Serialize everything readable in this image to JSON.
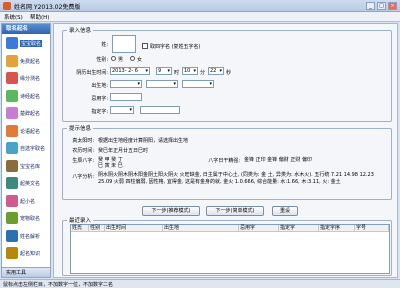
{
  "window": {
    "title": "姓名网 Y2013.02免费版",
    "btn_min": "_",
    "btn_max": "□",
    "btn_close": "×"
  },
  "menu": [
    "系统(S)",
    "帮助(H)"
  ],
  "sidebar": {
    "header": "取名起名",
    "items": [
      {
        "label": "宝宝取名",
        "color": "#3d7bd6"
      },
      {
        "label": "免费起名",
        "color": "#e6a23a"
      },
      {
        "label": "缘分测名",
        "color": "#d9534f"
      },
      {
        "label": "诗经起名",
        "color": "#5cb85c"
      },
      {
        "label": "楚辞起名",
        "color": "#c77dd4"
      },
      {
        "label": "论语起名",
        "color": "#e07b39"
      },
      {
        "label": "自选字取名",
        "color": "#4aa3c8"
      },
      {
        "label": "宝宝名库",
        "color": "#8a6d3b"
      },
      {
        "label": "起英文名",
        "color": "#3b8a7a"
      },
      {
        "label": "起小名",
        "color": "#d15b8f"
      },
      {
        "label": "宠物取名",
        "color": "#6b9e2e"
      },
      {
        "label": "姓名解析",
        "color": "#2c6fb2"
      },
      {
        "label": "起名知识",
        "color": "#b8860b"
      }
    ],
    "footer": "实用工具"
  },
  "form": {
    "legend_info": "录入信息",
    "surname_label": "姓:",
    "surname_value": "",
    "compound_label": "取四字名 (复姓五字名)",
    "gender_label": "性别:",
    "gender_male": "男",
    "gender_female": "女",
    "birth_label": "阴历出生时间:",
    "birth_date": "2013- 2- 6",
    "hour": "9",
    "hour_unit": "时",
    "minute": "10",
    "minute_unit": "分",
    "second": "22",
    "second_unit": "秒",
    "birthplace_label": "出生地:",
    "avoid_label": "忌用字:",
    "fixed_label": "指定字:"
  },
  "tips": {
    "legend": "提示信息",
    "true_time_label": "真太阳时:",
    "true_time_value": "根据出生地经度计算阴阳，请选择出生地",
    "lunar_label": "农历时间:",
    "lunar_value": "癸巳年正月廿五日巳时",
    "bazi_label": "生辰八字:",
    "bazi_value": "癸 甲 癸 丁  巳 寅 未 巳",
    "nayin_label": "八字日干精强:",
    "nayin_value": "金锋  正印  金锋  偏财  正财  偏印",
    "analysis_label": "八字分析:",
    "analysis_value": "阴水阴火阴木阴木阳金阴土阳火阴火 火旺缺金, 日主属于中心土, (同类为: 金 土, 异类为: 水木火). 五行统 7.21 14.98 12.23 25.09 火弱 四柱偏弱, 因性格, 宜得金, 这是有金身的就, 金火 1.0.666, 综合能量: 水:1.66, 木:3.11, 火: 金土"
  },
  "buttons": {
    "next_recommend": "下一步(推荐模式)",
    "next_simple": "下一步(简单模式)",
    "reset": "重设"
  },
  "recent": {
    "legend": "最近录入",
    "columns": [
      "姓氏",
      "性别",
      "出生时间",
      "出生地",
      "忌用字",
      "指定字",
      "指定字序",
      "字号"
    ]
  },
  "status": "鼠标点击左侧栏目，不加数字一位，不加数字二名"
}
